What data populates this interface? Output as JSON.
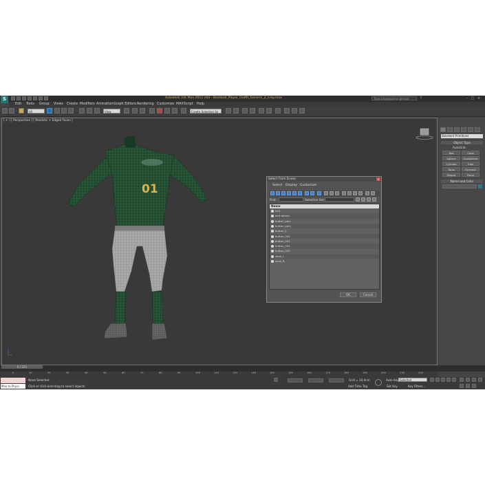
{
  "app": {
    "title": "Autodesk 3ds Max 2012 x64 - Baseball_Player_Outfit_Generic_2_vray.max",
    "search_placeholder": "Type a keyword or phrase",
    "logo_text": "S"
  },
  "menu": [
    "Edit",
    "Tools",
    "Group",
    "Views",
    "Create",
    "Modifiers",
    "Animation",
    "Graph Editors",
    "Rendering",
    "Customize",
    "MAXScript",
    "Help"
  ],
  "toolbar": {
    "filter_value": "All",
    "coord_value": "View",
    "selection_set": "Create Selection Se"
  },
  "viewport": {
    "label": "[ + ] [ Perspective ] [ Realistic + Edged Faces ]",
    "jersey_number": "01"
  },
  "command_panel": {
    "dropdown": "Standard Primitives",
    "object_type_header": "Object Type",
    "autogrid_label": "AutoGrid",
    "buttons": [
      "Box",
      "Cone",
      "Sphere",
      "GeoSphere",
      "Cylinder",
      "Tube",
      "Torus",
      "Pyramid",
      "Teapot",
      "Plane"
    ],
    "name_color_header": "Name and Color"
  },
  "timeline": {
    "slider": "0 / 225",
    "ticks": [
      "0",
      "10",
      "20",
      "30",
      "40",
      "50",
      "60",
      "70",
      "80",
      "90",
      "100",
      "110",
      "120",
      "130",
      "140",
      "150",
      "160",
      "170",
      "180",
      "190",
      "200",
      "210",
      "220"
    ]
  },
  "status": {
    "maxscript_text": "Max to Physc",
    "none_selected": "None Selected",
    "prompt": "Click or click-and-drag to select objects",
    "grid": "Grid = 10,0cm",
    "auto_key": "Auto Key",
    "set_key": "Set Key",
    "selected": "Selected",
    "key_filters": "Key Filters...",
    "add_time_tag": "Add Time Tag"
  },
  "dialog": {
    "title": "Select From Scene",
    "menu": [
      "Select",
      "Display",
      "Customize"
    ],
    "find_label": "Find:",
    "selection_set_label": "Selection Set:",
    "list_header": "Name",
    "items": [
      "belt",
      "belt details",
      "button_part",
      "button_part_",
      "button_1",
      "button_002",
      "button_003",
      "button_004",
      "button_005",
      "shoe_L",
      "shoe_R"
    ],
    "ok": "OK",
    "cancel": "Cancel"
  }
}
